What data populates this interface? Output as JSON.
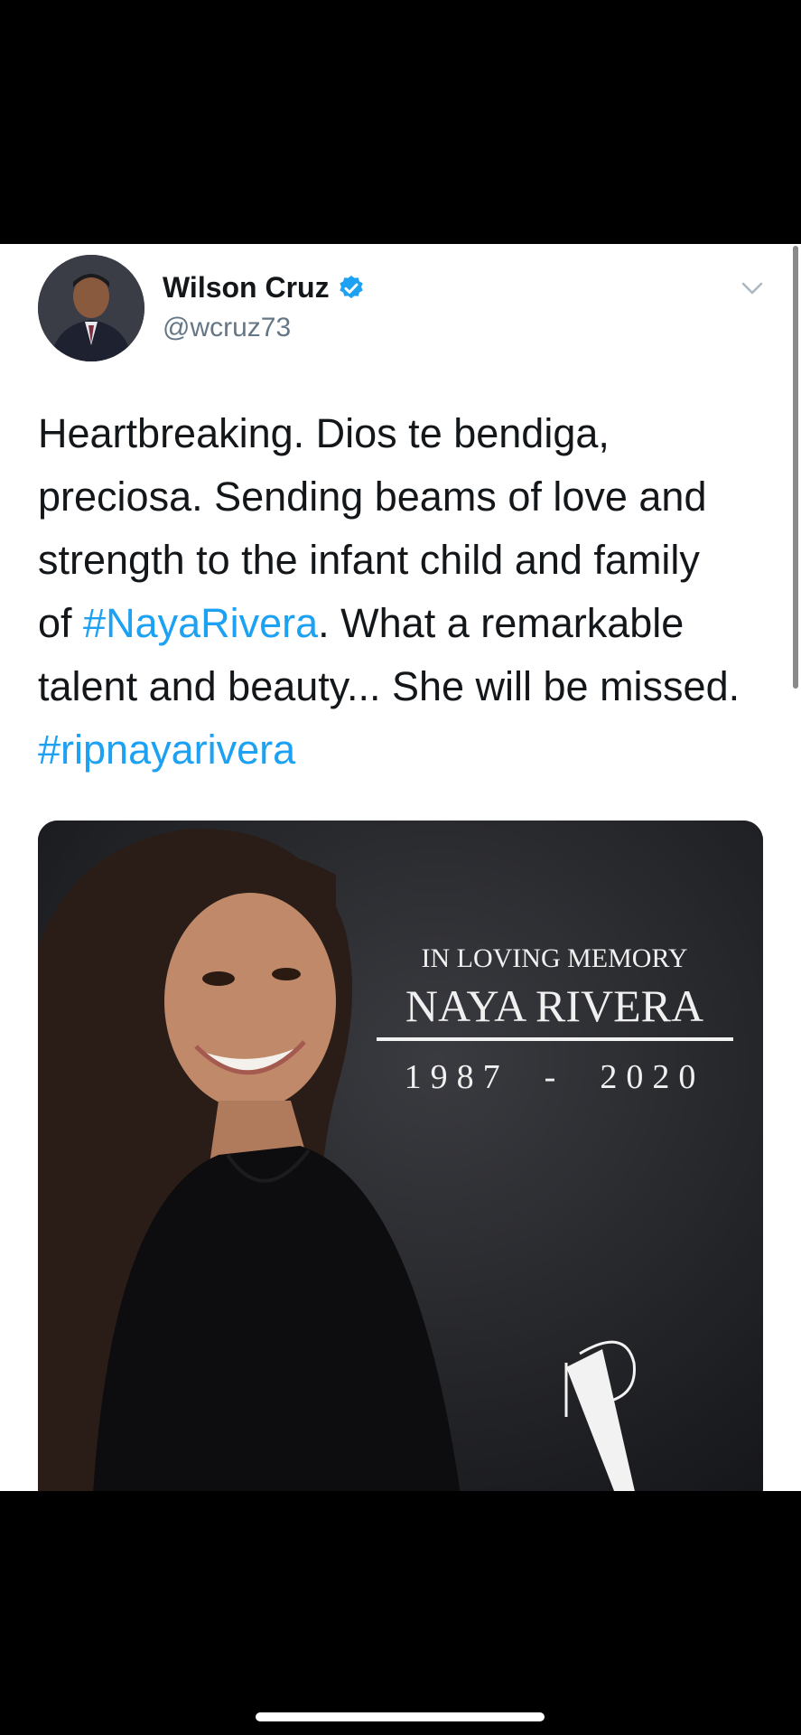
{
  "tweet": {
    "author": {
      "display_name": "Wilson Cruz",
      "handle": "@wcruz73",
      "verified_icon": "verified-badge-icon",
      "avatar": "avatar-photo"
    },
    "menu_icon": "chevron-down-icon",
    "text": {
      "line1": "Heartbreaking. Dios te bendiga,",
      "line2": "preciosa. Sending beams of love and",
      "line3": "strength to the infant child and family",
      "line4_prefix": "of ",
      "hashtag1": "#NayaRivera",
      "line4_suffix": ". What a remarkable",
      "line5": "talent and beauty... She will be missed.",
      "hashtag2": "#ripnayarivera"
    },
    "media": {
      "caption_top": "IN LOVING MEMORY",
      "caption_name": "NAYA RIVERA",
      "caption_years": "1987  -  2020"
    }
  },
  "colors": {
    "accent": "#1da1f2",
    "text": "#14171a",
    "secondary": "#657786",
    "background": "#ffffff",
    "chrome": "#000000"
  }
}
